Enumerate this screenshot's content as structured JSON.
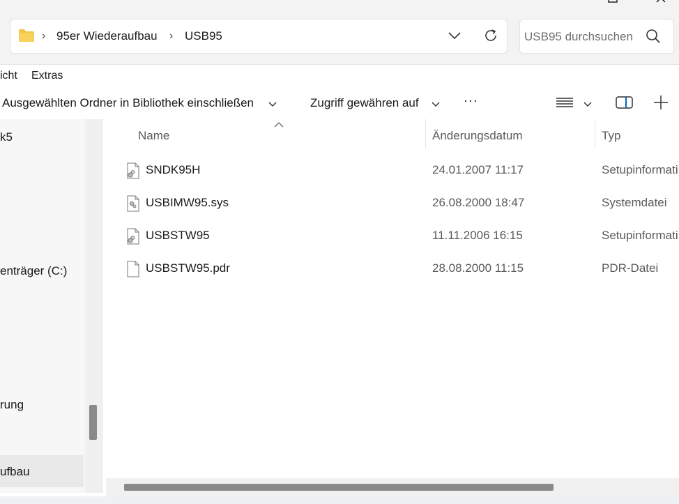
{
  "address_bar": {
    "breadcrumbs": [
      "95er Wiederaufbau",
      "USB95"
    ],
    "search_placeholder": "USB95 durchsuchen"
  },
  "menu": {
    "items": [
      "icht",
      "Extras"
    ]
  },
  "toolbar": {
    "include_library_label": "Ausgewählten Ordner in Bibliothek einschließen",
    "grant_access_label": "Zugriff gewähren auf",
    "more_label": "···"
  },
  "nav": {
    "items": [
      "k5",
      "enträger (C:)",
      "rung",
      "ufbau"
    ]
  },
  "file_list": {
    "columns": [
      "Name",
      "Änderungsdatum",
      "Typ"
    ],
    "rows": [
      {
        "name": "SNDK95H",
        "date": "24.01.2007 11:17",
        "type": "Setupinformati",
        "icon": "setup-info-icon"
      },
      {
        "name": "USBIMW95.sys",
        "date": "26.08.2000 18:47",
        "type": "Systemdatei",
        "icon": "system-file-icon"
      },
      {
        "name": "USBSTW95",
        "date": "11.11.2006 16:15",
        "type": "Setupinformati",
        "icon": "setup-info-icon"
      },
      {
        "name": "USBSTW95.pdr",
        "date": "28.08.2000 11:15",
        "type": "PDR-Datei",
        "icon": "blank-file-icon"
      }
    ]
  },
  "colors": {
    "chrome_bg": "#f3f3f3",
    "folder_yellow": "#f4c542",
    "scroll_thumb": "#8a8a8a"
  }
}
